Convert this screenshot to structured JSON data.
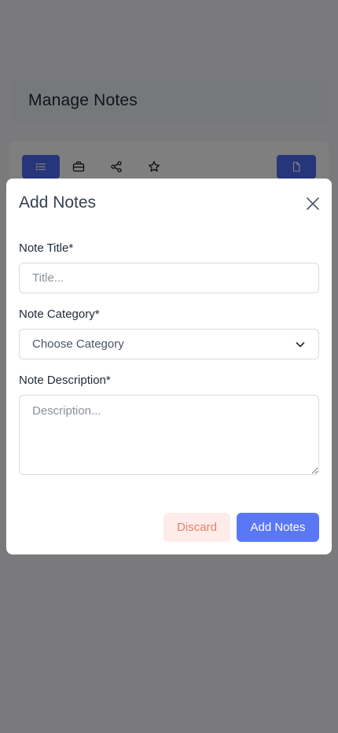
{
  "background": {
    "page_title": "Manage Notes",
    "toolbar": {
      "buttons": [
        {
          "name": "list-view",
          "icon": "list-icon",
          "active": true
        },
        {
          "name": "briefcase",
          "icon": "briefcase-icon",
          "active": false
        },
        {
          "name": "share",
          "icon": "share-icon",
          "active": false
        },
        {
          "name": "favorite",
          "icon": "star-icon",
          "active": false
        },
        {
          "name": "document",
          "icon": "document-icon",
          "active": true
        }
      ]
    }
  },
  "modal": {
    "title": "Add Notes",
    "close_icon": "close-icon",
    "fields": {
      "title": {
        "label": "Note Title*",
        "value": "",
        "placeholder": "Title..."
      },
      "category": {
        "label": "Note Category*",
        "selected": "Choose Category"
      },
      "description": {
        "label": "Note Description*",
        "value": "",
        "placeholder": "Description..."
      }
    },
    "discard_label": "Discard",
    "submit_label": "Add Notes"
  },
  "colors": {
    "accent": "#5a78f5",
    "discard_bg": "#fdecea",
    "discard_text": "#e8826b",
    "overlay": "rgba(0,0,0,0.5)"
  }
}
